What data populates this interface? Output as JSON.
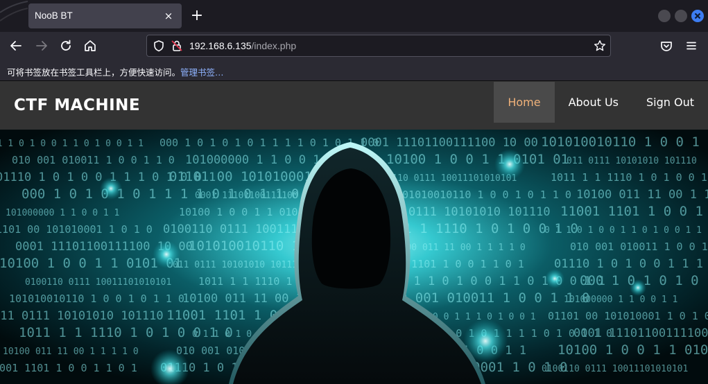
{
  "browser": {
    "tab_title": "NooB BT",
    "tab_close": "×",
    "new_tab": "+",
    "url_host": "192.168.6.135",
    "url_path": "/index.php",
    "bookmarks_hint": "可将书签放在书签工具栏上，方便快速访问。",
    "bookmarks_link": "管理书签…"
  },
  "site": {
    "brand": "CTF MACHINE",
    "nav": [
      {
        "label": "Home",
        "active": true
      },
      {
        "label": "About Us",
        "active": false
      },
      {
        "label": "Sign Out",
        "active": false
      }
    ]
  },
  "hero": {
    "image": "hooded-hacker-binary-background",
    "binary_lines": [
      "0 1 1 0 1 0 0 1  1 0 1 0 0 1 1",
      "010   001  010011  1 0  0 1 1 0",
      "01110  1 0 1 0 0 1 1 1 0 1 0 0 1",
      "000 1 0 1 0 1  0 1 1 1 1 0 1 0 1 1 0",
      "101000000   1 1 0 0 1 1",
      "01101  00   101010001   1 0 1 0",
      "0001  11101100111100   10  00",
      "10100  1 0 0 1 1   0101   01",
      "0100110 0111 10011101010101",
      "101010010110 1 0  0 1 0 1 1 0",
      "011   0111  10101010 101110",
      "1011  1 1  1110 1 0 1 0  0 1 0",
      "10100 011 11   00  1 1 1  1 0",
      "11001   1101 1 0   0 1 1 0 1"
    ]
  },
  "colors": {
    "tabbar": "#1c1b22",
    "toolbar": "#2b2a33",
    "header": "#333333",
    "active_nav": "#f0b27a",
    "accent_glow": "#38e8f0"
  }
}
